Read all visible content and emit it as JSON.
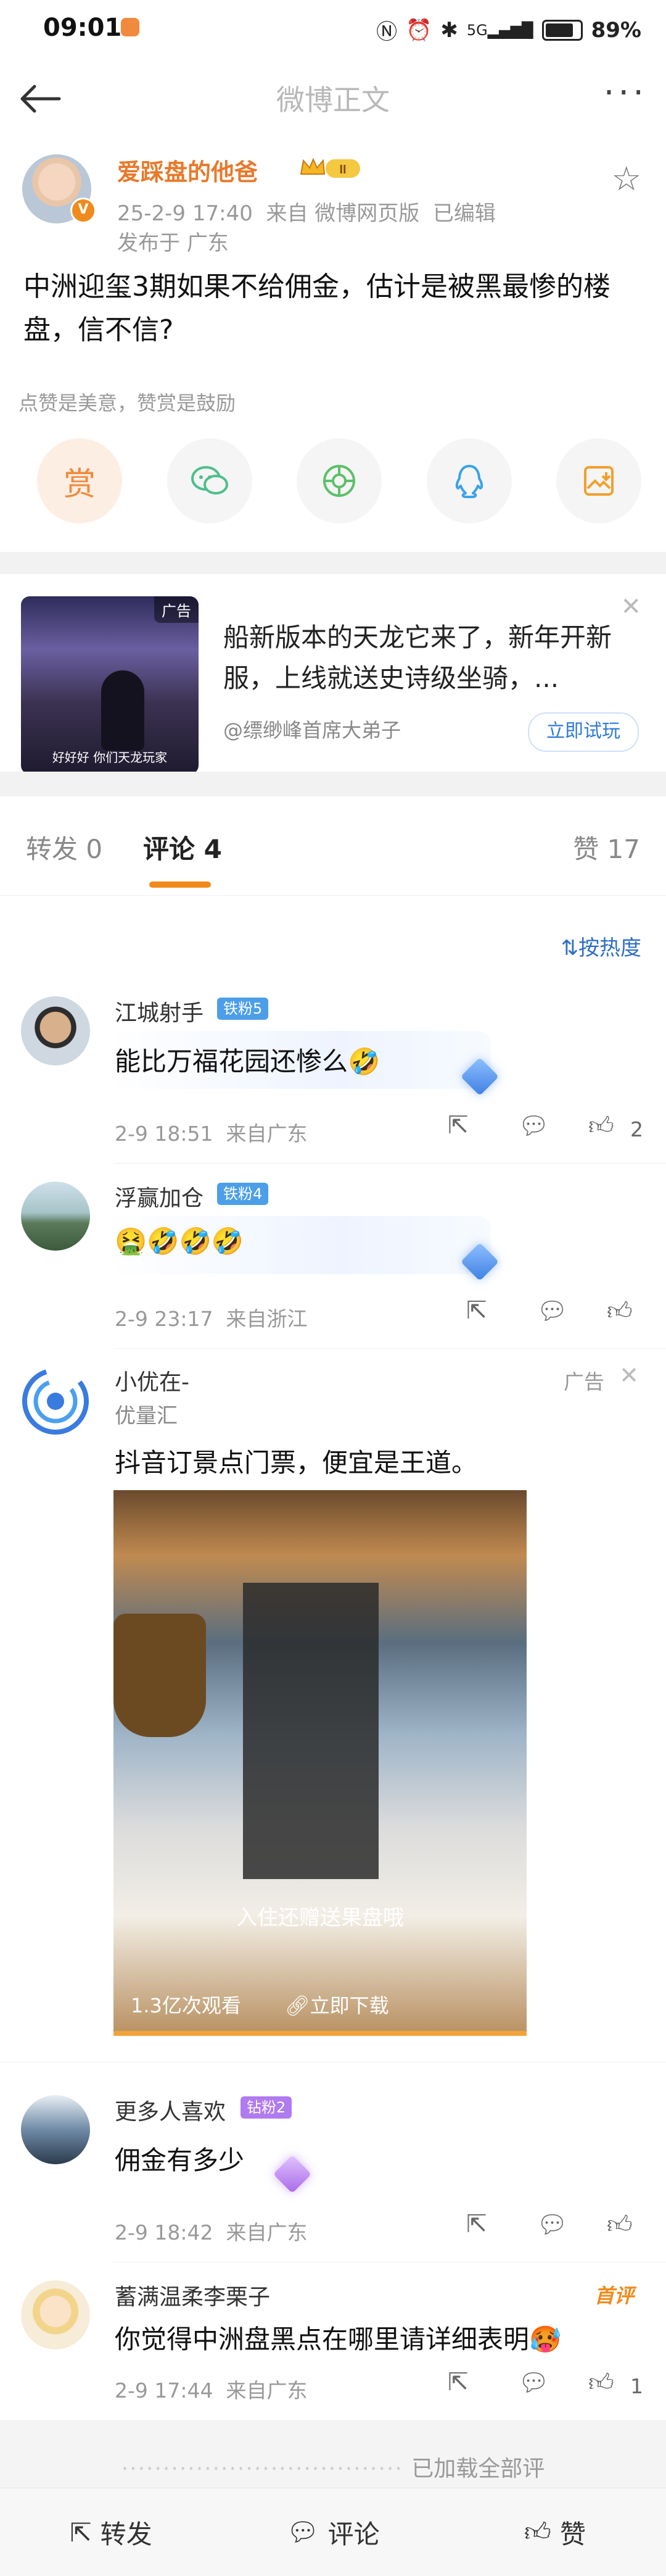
{
  "status_bar": {
    "time": "09:01",
    "signal": "5G",
    "battery": "89%"
  },
  "nav": {
    "title": "微博正文"
  },
  "post": {
    "author": "爱踩盘的他爸",
    "level_badge": "II",
    "time": "25-2-9 17:40",
    "source": "来自 微博网页版",
    "edited": "已编辑",
    "location": "发布于 广东",
    "text": "中洲迎玺3期如果不给佣金，估计是被黑最惨的楼盘，信不信?",
    "reward_tip": "点赞是美意，赞赏是鼓励",
    "share_icons": [
      "reward-icon",
      "wechat-icon",
      "moments-icon",
      "qq-icon",
      "save-image-icon"
    ],
    "reward_label": "赏"
  },
  "ad_banner": {
    "tag": "广告",
    "image_caption": "好好好 你们天龙玩家",
    "text": "船新版本的天龙它来了，新年开新服，上线就送史诗级坐骑，...",
    "source": "@缥缈峰首席大弟子",
    "button": "立即试玩"
  },
  "tabs": {
    "repost": "转发 0",
    "comments": "评论 4",
    "likes": "赞 17",
    "sort": "按热度"
  },
  "comments": [
    {
      "name": "江城射手",
      "badge": "铁粉5",
      "text": "能比万福花园还惨么🤣",
      "time": "2-9 18:51",
      "location": "来自广东",
      "likes": "2"
    },
    {
      "name": "浮赢加仓",
      "badge": "铁粉4",
      "text": "🤮🤣🤣🤣",
      "time": "2-9 23:17",
      "location": "来自浙江",
      "likes": ""
    }
  ],
  "ad_comment": {
    "name": "小优在-",
    "sub": "优量汇",
    "tag": "广告",
    "text": "抖音订景点门票，便宜是王道。",
    "video_caption": "入住还赠送果盘哦",
    "views": "1.3亿次观看",
    "download": "立即下载"
  },
  "comments2": [
    {
      "name": "更多人喜欢",
      "badge": "钻粉2",
      "text": "佣金有多少",
      "time": "2-9 18:42",
      "location": "来自广东",
      "likes": ""
    },
    {
      "name": "蓄满温柔李栗子",
      "badge": "首评",
      "text": "你觉得中洲盘黑点在哪里请详细表明🥵",
      "time": "2-9 17:44",
      "location": "来自广东",
      "likes": "1"
    }
  ],
  "footer": {
    "loaded": "已加载全部评论",
    "repost": "转发",
    "comment": "评论",
    "like": "赞"
  }
}
